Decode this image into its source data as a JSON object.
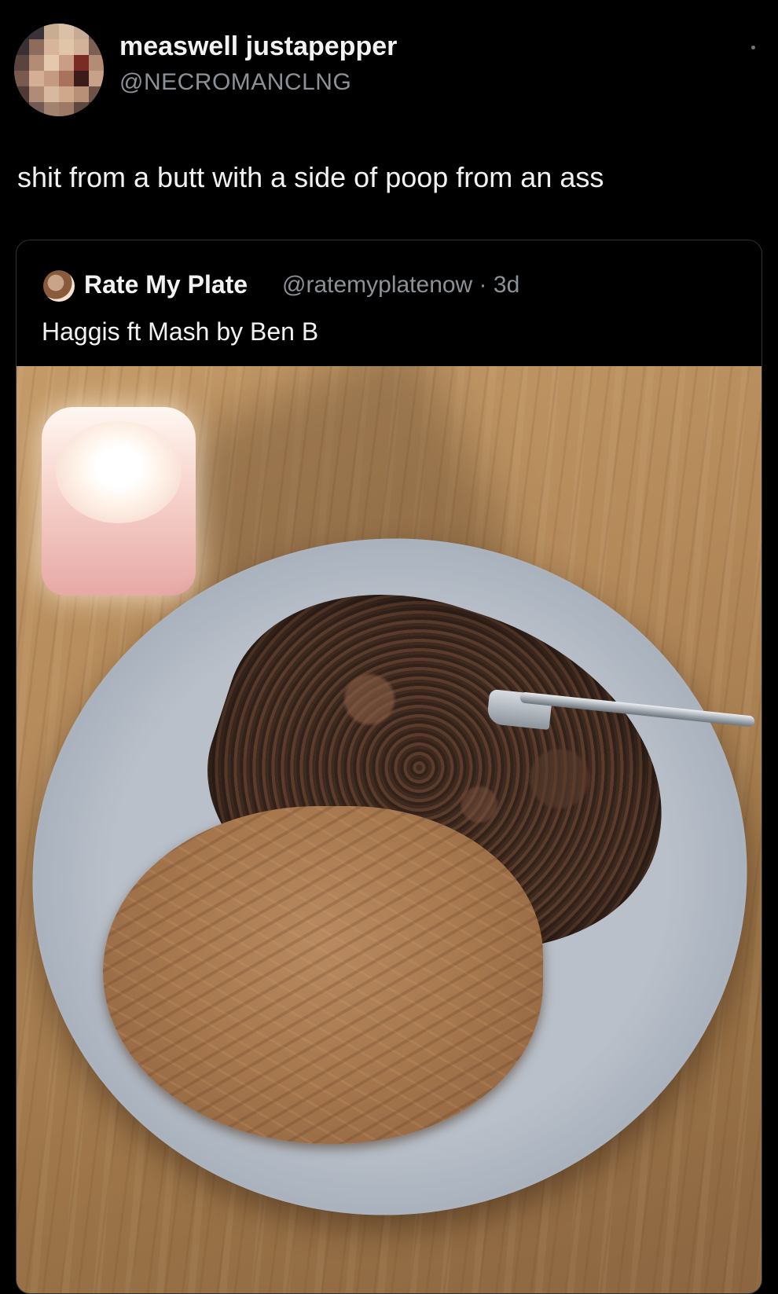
{
  "tweet": {
    "display_name": "measwell justapepper",
    "handle": "@NECROMANCLNG",
    "text": "shit from a butt with a side of poop from an ass"
  },
  "quoted_tweet": {
    "display_name": "Rate My Plate",
    "handle_time": "@ratemyplatenow · 3d",
    "text": "Haggis ft Mash by Ben B"
  },
  "icons": {
    "menu": "more-options-icon"
  },
  "colors": {
    "background": "#000000",
    "text": "#e7e9ea",
    "secondary_text": "#8b9196"
  }
}
